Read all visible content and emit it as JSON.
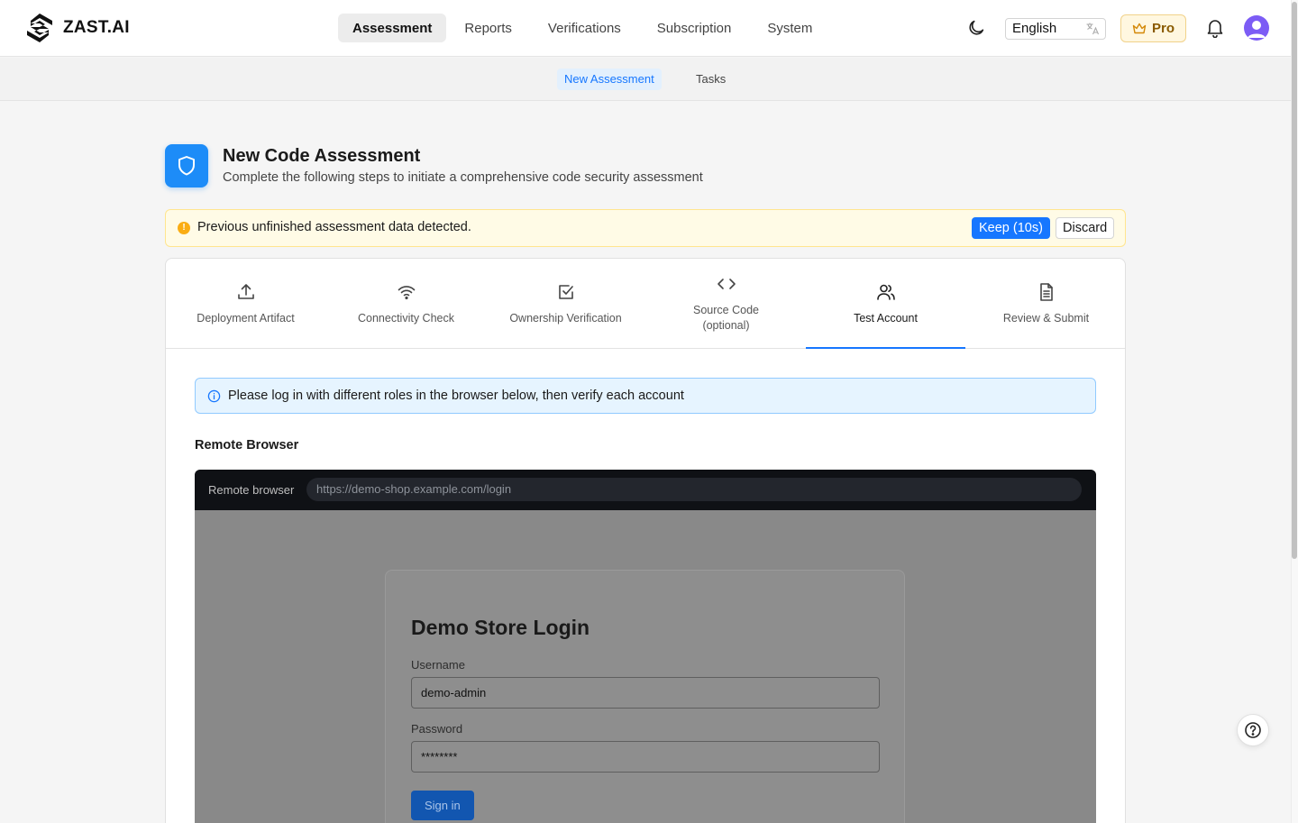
{
  "brand": {
    "name": "ZAST.AI"
  },
  "mainnav": {
    "items": [
      {
        "label": "Assessment",
        "active": true
      },
      {
        "label": "Reports"
      },
      {
        "label": "Verifications"
      },
      {
        "label": "Subscription"
      },
      {
        "label": "System"
      }
    ]
  },
  "topbar": {
    "language": "English",
    "plan": "Pro"
  },
  "subnav": {
    "items": [
      {
        "label": "New Assessment",
        "active": true
      },
      {
        "label": "Tasks"
      }
    ]
  },
  "header": {
    "title": "New Code Assessment",
    "description": "Complete the following steps to initiate a comprehensive code security assessment"
  },
  "warning": {
    "text": "Previous unfinished assessment data detected.",
    "keep_label": "Keep (10s)",
    "discard_label": "Discard",
    "color": "#faad14"
  },
  "steps": [
    {
      "label": "Deployment Artifact",
      "icon": "upload-icon"
    },
    {
      "label": "Connectivity Check",
      "icon": "wifi-icon"
    },
    {
      "label": "Ownership Verification",
      "icon": "check-square-icon"
    },
    {
      "label": "Source Code",
      "label2": "(optional)",
      "icon": "code-icon"
    },
    {
      "label": "Test Account",
      "icon": "users-icon",
      "active": true
    },
    {
      "label": "Review & Submit",
      "icon": "document-icon"
    }
  ],
  "info": {
    "text": "Please log in with different roles in the browser below, then verify each account"
  },
  "remote_browser": {
    "section_title": "Remote Browser",
    "bar_label": "Remote browser",
    "url": "https://demo-shop.example.com/login",
    "page": {
      "title": "Demo Store Login",
      "username_label": "Username",
      "username_value": "demo-admin",
      "password_label": "Password",
      "password_value": "********",
      "signin_label": "Sign in"
    }
  },
  "colors": {
    "accent": "#1677ff",
    "brand_icon": "#1d8cf8"
  }
}
